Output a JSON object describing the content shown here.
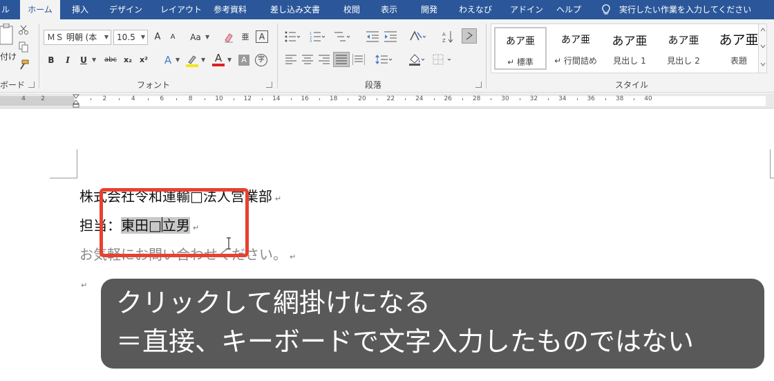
{
  "tabs": [
    {
      "label": "ル",
      "active": false
    },
    {
      "label": "ホーム",
      "active": true
    },
    {
      "label": "挿入",
      "active": false
    },
    {
      "label": "デザイン",
      "active": false
    },
    {
      "label": "レイアウト",
      "active": false
    },
    {
      "label": "参考資料",
      "active": false
    },
    {
      "label": "差し込み文書",
      "active": false
    },
    {
      "label": "校閲",
      "active": false
    },
    {
      "label": "表示",
      "active": false
    },
    {
      "label": "開発",
      "active": false
    },
    {
      "label": "わえなび",
      "active": false
    },
    {
      "label": "アドイン",
      "active": false
    },
    {
      "label": "ヘルプ",
      "active": false
    }
  ],
  "tell_me": {
    "icon": "lightbulb-icon",
    "text": "実行したい作業を入力してください"
  },
  "ribbon": {
    "clipboard": {
      "paste_label": "付け",
      "group_label": "ボード"
    },
    "font": {
      "font_name": "ＭＳ 明朝 (本",
      "font_size": "10.5",
      "grow": "A",
      "shrink": "A",
      "change_case": "Aa",
      "phonetic": "亜",
      "border_char": "A",
      "bold": "B",
      "italic": "I",
      "underline": "U",
      "strike": "abc",
      "subscript": "x₂",
      "superscript": "x²",
      "effects": "A",
      "font_color": "A",
      "shading_char": "A",
      "enclose_char": "字",
      "group_label": "フォント"
    },
    "paragraph": {
      "group_label": "段落"
    },
    "styles": {
      "group_label": "スタイル",
      "items": [
        {
          "preview": "あア亜",
          "name": "↵ 標準",
          "selected": true
        },
        {
          "preview": "あア亜",
          "name": "↵ 行間詰め",
          "selected": false
        },
        {
          "preview": "あア亜",
          "name": "見出し 1",
          "selected": false
        },
        {
          "preview": "あア亜",
          "name": "見出し 2",
          "selected": false
        },
        {
          "preview": "あア亜",
          "name": "表題",
          "selected": false
        }
      ]
    }
  },
  "ruler": {
    "left_numbers": [
      "4",
      "2"
    ],
    "numbers": [
      "2",
      "4",
      "6",
      "8",
      "10",
      "12",
      "14",
      "16",
      "18",
      "20",
      "22",
      "24",
      "26",
      "28",
      "30",
      "32",
      "34",
      "36",
      "38",
      "40"
    ]
  },
  "document": {
    "line1": "株式会社令和運輸□法人営業部",
    "line2_prefix": "担当：",
    "line2_shaded_a": "東田□",
    "line2_shaded_b": "立男",
    "line3": "お気軽にお問い合わせください。",
    "para_mark": "↵"
  },
  "caption": {
    "line1": "クリックして網掛けになる",
    "line2": "＝直接、キーボードで文字入力したものではない"
  },
  "colors": {
    "tab_bar": "#2b579a",
    "highlight": "#e8412f",
    "caption_bg": "#505050"
  }
}
